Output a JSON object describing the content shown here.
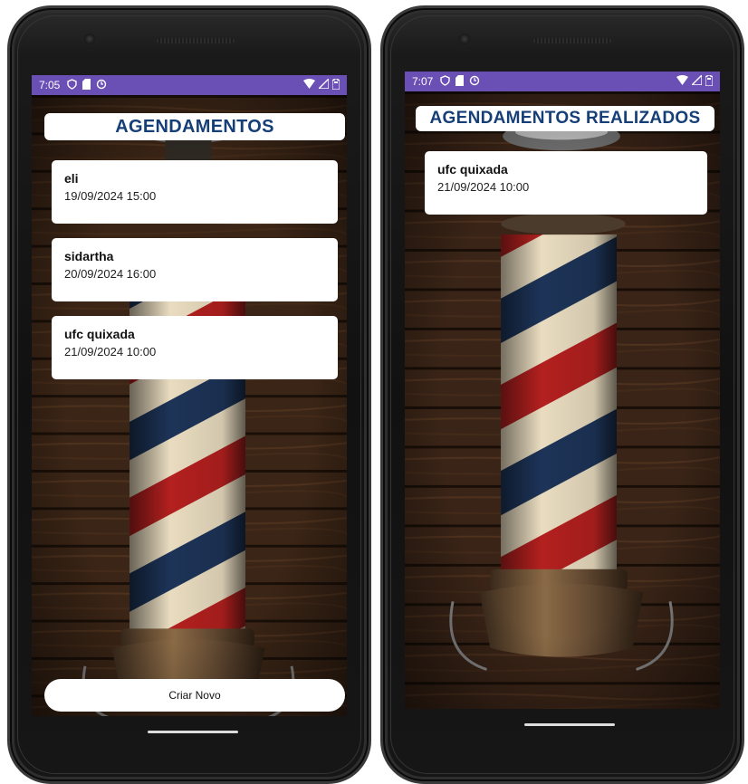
{
  "colors": {
    "status_bar": "#6a4fb4",
    "title_text": "#163f78",
    "card_bg": "#ffffff",
    "pole_red": "#b3201f",
    "pole_blue": "#1d3458",
    "pole_cream": "#e9dcc0"
  },
  "left_screen": {
    "status_bar": {
      "time": "7:05",
      "icons": [
        "shield-icon",
        "sim-icon",
        "sync-icon"
      ],
      "right_icons": [
        "wifi-icon",
        "signal-icon",
        "battery-icon"
      ]
    },
    "title": "AGENDAMENTOS",
    "appointments": [
      {
        "name": "eli",
        "datetime": "19/09/2024 15:00"
      },
      {
        "name": "sidartha",
        "datetime": "20/09/2024 16:00"
      },
      {
        "name": "ufc quixada",
        "datetime": "21/09/2024 10:00"
      }
    ],
    "create_button": "Criar Novo"
  },
  "right_screen": {
    "status_bar": {
      "time": "7:07",
      "icons": [
        "shield-icon",
        "sim-icon",
        "sync-icon"
      ],
      "right_icons": [
        "wifi-icon",
        "signal-icon",
        "battery-icon"
      ]
    },
    "title": "AGENDAMENTOS REALIZADOS",
    "appointments": [
      {
        "name": "ufc quixada",
        "datetime": "21/09/2024 10:00"
      }
    ]
  }
}
